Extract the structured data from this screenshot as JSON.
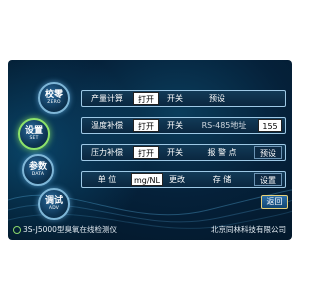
{
  "sidebar": {
    "items": [
      {
        "label": "校零",
        "sub": "ZERO"
      },
      {
        "label": "设置",
        "sub": "SET"
      },
      {
        "label": "参数",
        "sub": "DATA"
      },
      {
        "label": "调试",
        "sub": "ADV"
      }
    ]
  },
  "rows": [
    {
      "name": "产量计算",
      "open": "打开",
      "close": "开关",
      "action": "预设"
    },
    {
      "name": "温度补偿",
      "open": "打开",
      "close": "开关",
      "field_label": "RS-485地址",
      "field_value": "155"
    },
    {
      "name": "压力补偿",
      "open": "打开",
      "close": "开关",
      "field_label": "报 警 点",
      "action": "预设"
    },
    {
      "name": "单   位",
      "unit_value": "mg/NL",
      "change": "更改",
      "field_label": "存   储",
      "action": "设置"
    }
  ],
  "back_label": "返回",
  "footer": {
    "model": "3S-J5000型臭氧在线检测仪",
    "company": "北京同林科技有限公司"
  }
}
